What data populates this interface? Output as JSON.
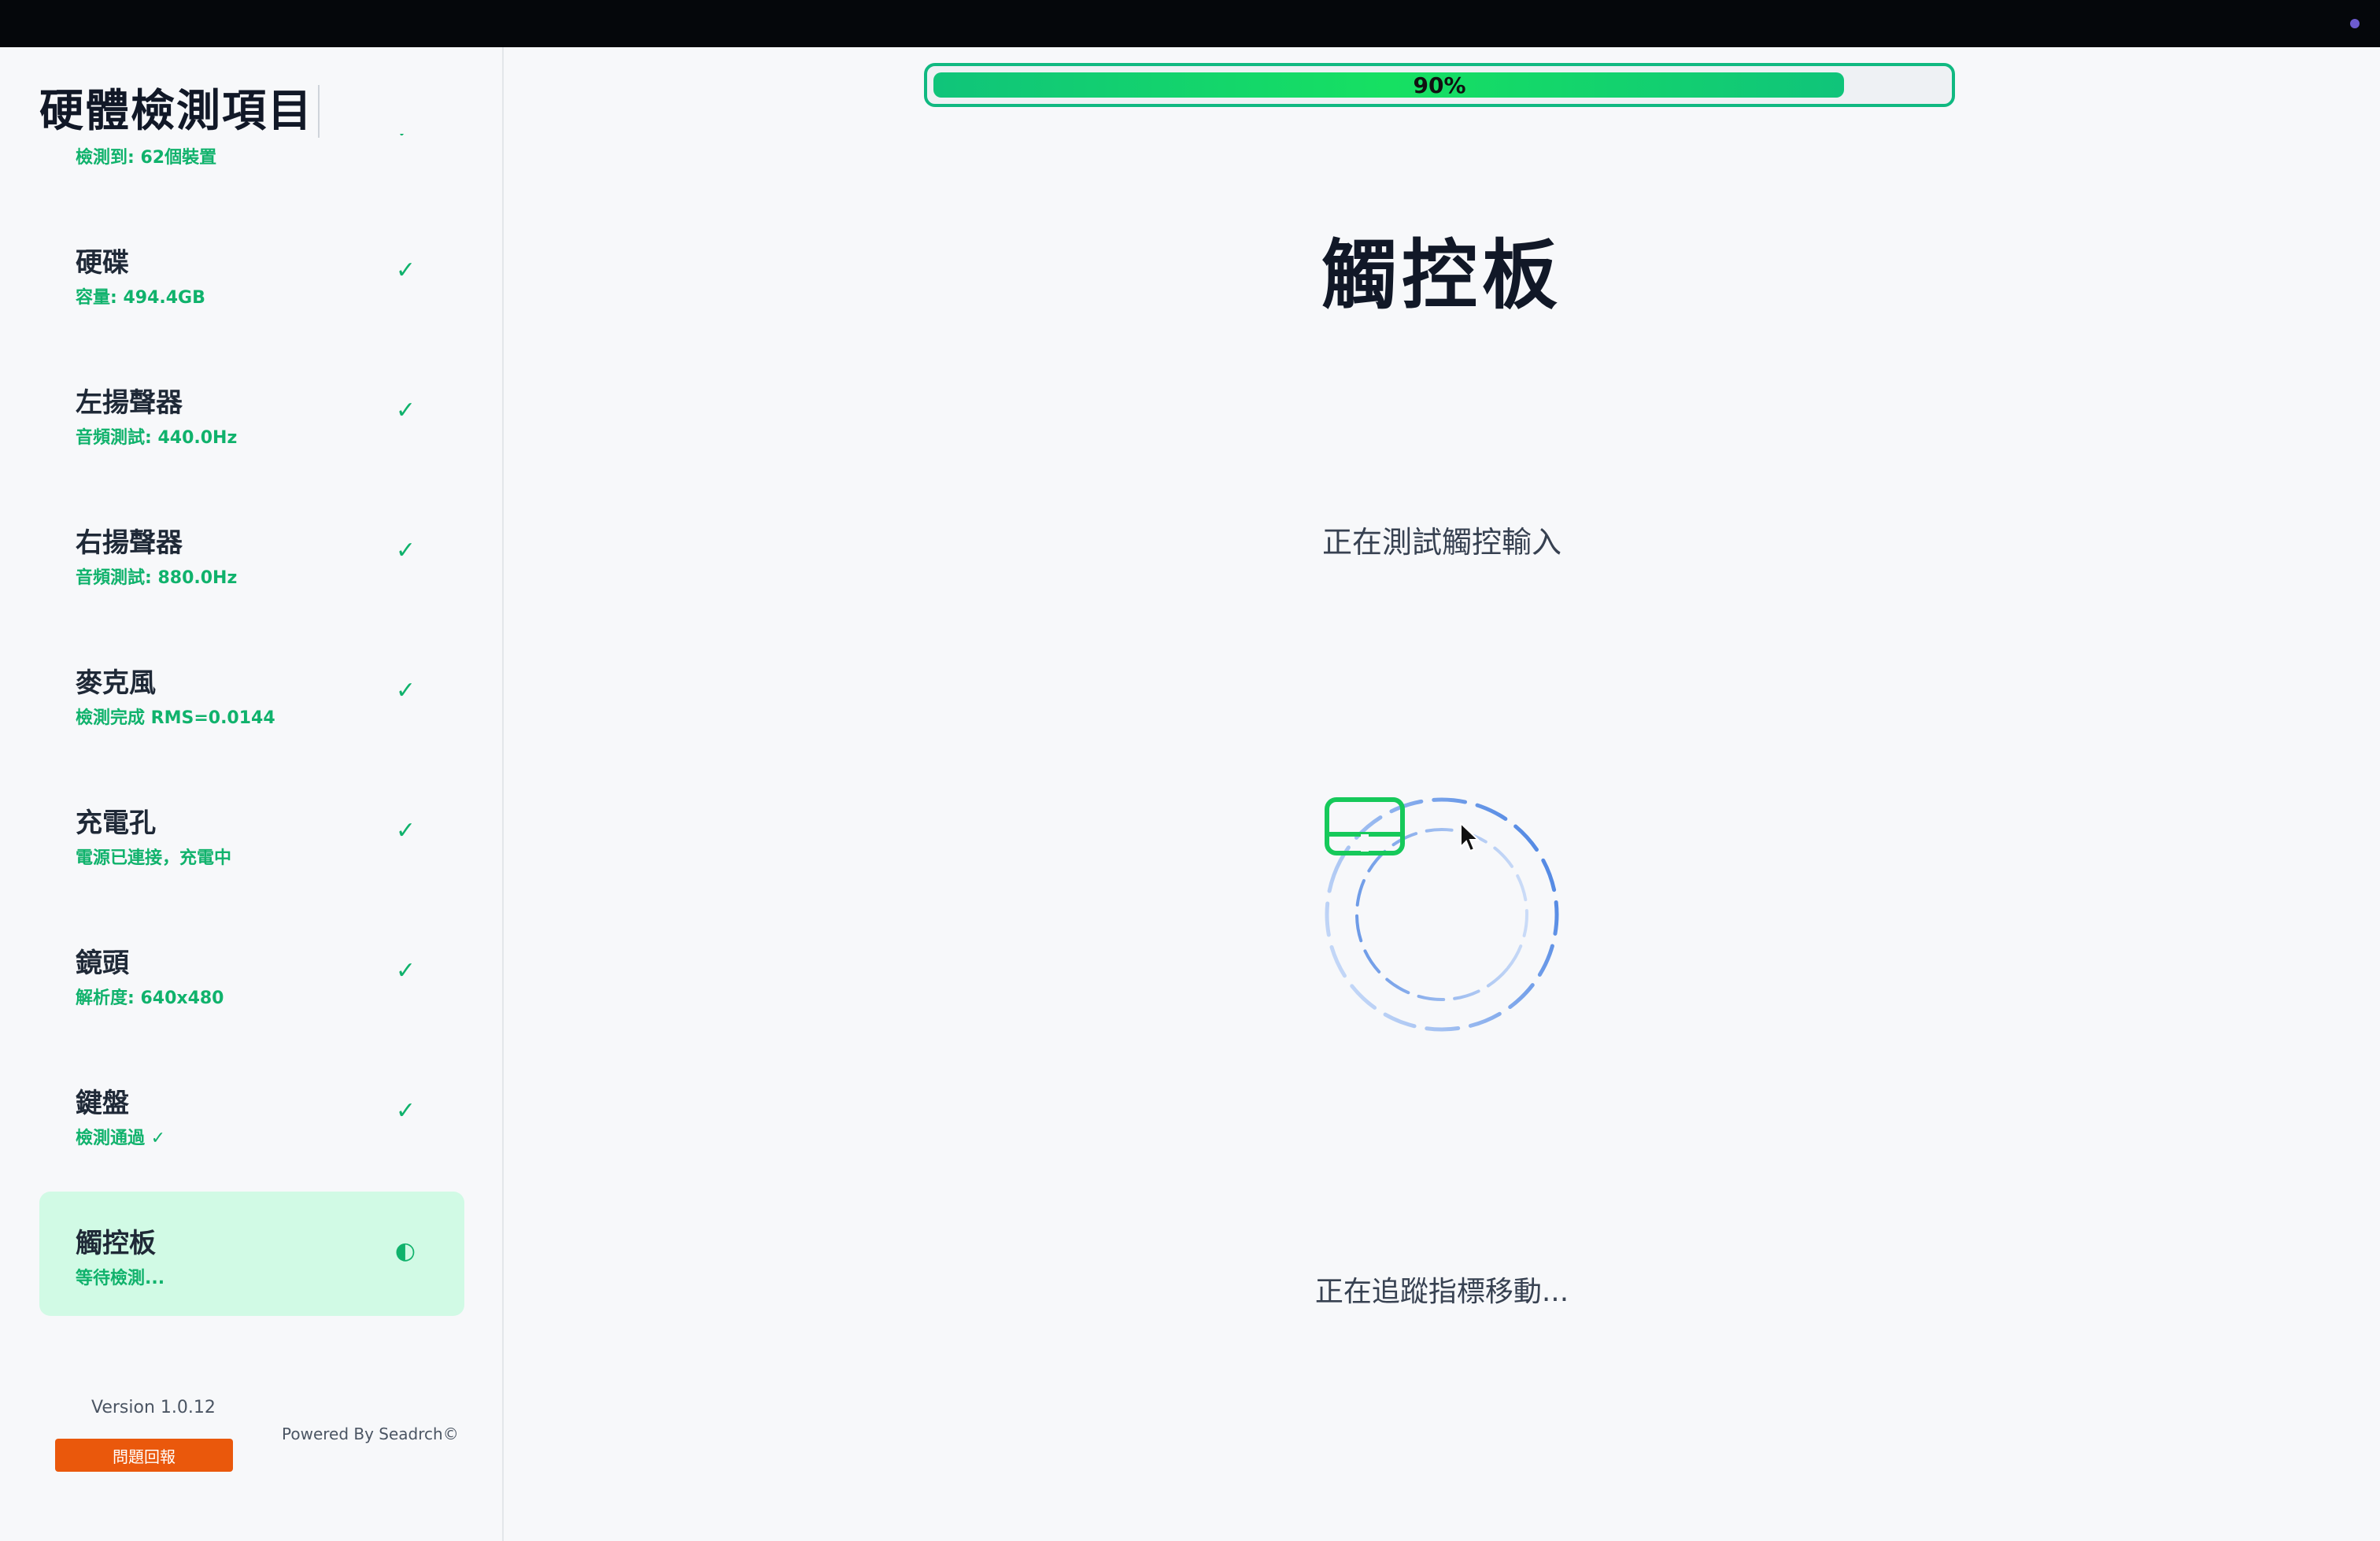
{
  "sidebar": {
    "title": "硬體檢測項目",
    "items": [
      {
        "name": "",
        "status": "檢測到: 62個裝置",
        "icon": "✓"
      },
      {
        "name": "硬碟",
        "status": "容量: 494.4GB",
        "icon": "✓"
      },
      {
        "name": "左揚聲器",
        "status": "音頻測試: 440.0Hz",
        "icon": "✓"
      },
      {
        "name": "右揚聲器",
        "status": "音頻測試: 880.0Hz",
        "icon": "✓"
      },
      {
        "name": "麥克風",
        "status": "檢測完成 RMS=0.0144",
        "icon": "✓"
      },
      {
        "name": "充電孔",
        "status": "電源已連接，充電中",
        "icon": "✓"
      },
      {
        "name": "鏡頭",
        "status": "解析度: 640x480",
        "icon": "✓"
      },
      {
        "name": "鍵盤",
        "status": "檢測通過 ✓",
        "icon": "✓"
      },
      {
        "name": "觸控板",
        "status": "等待檢測...",
        "icon": "◐"
      }
    ],
    "version": "Version 1.0.12",
    "powered_by": "Powered By Seadrch©",
    "report_button": "問題回報"
  },
  "main": {
    "progress": {
      "label": "90%",
      "value": 0.9
    },
    "title": "觸控板",
    "subtitle": "正在測試觸控輸入",
    "tracking_text": "正在追蹤指標移動...",
    "icon": "trackpad-icon"
  },
  "colors": {
    "accent_green": "#10b981",
    "status_green": "#10b26c",
    "active_item_bg": "#d1fae5",
    "report_orange": "#ea580c",
    "spinner_blue": "#4a86e8"
  }
}
